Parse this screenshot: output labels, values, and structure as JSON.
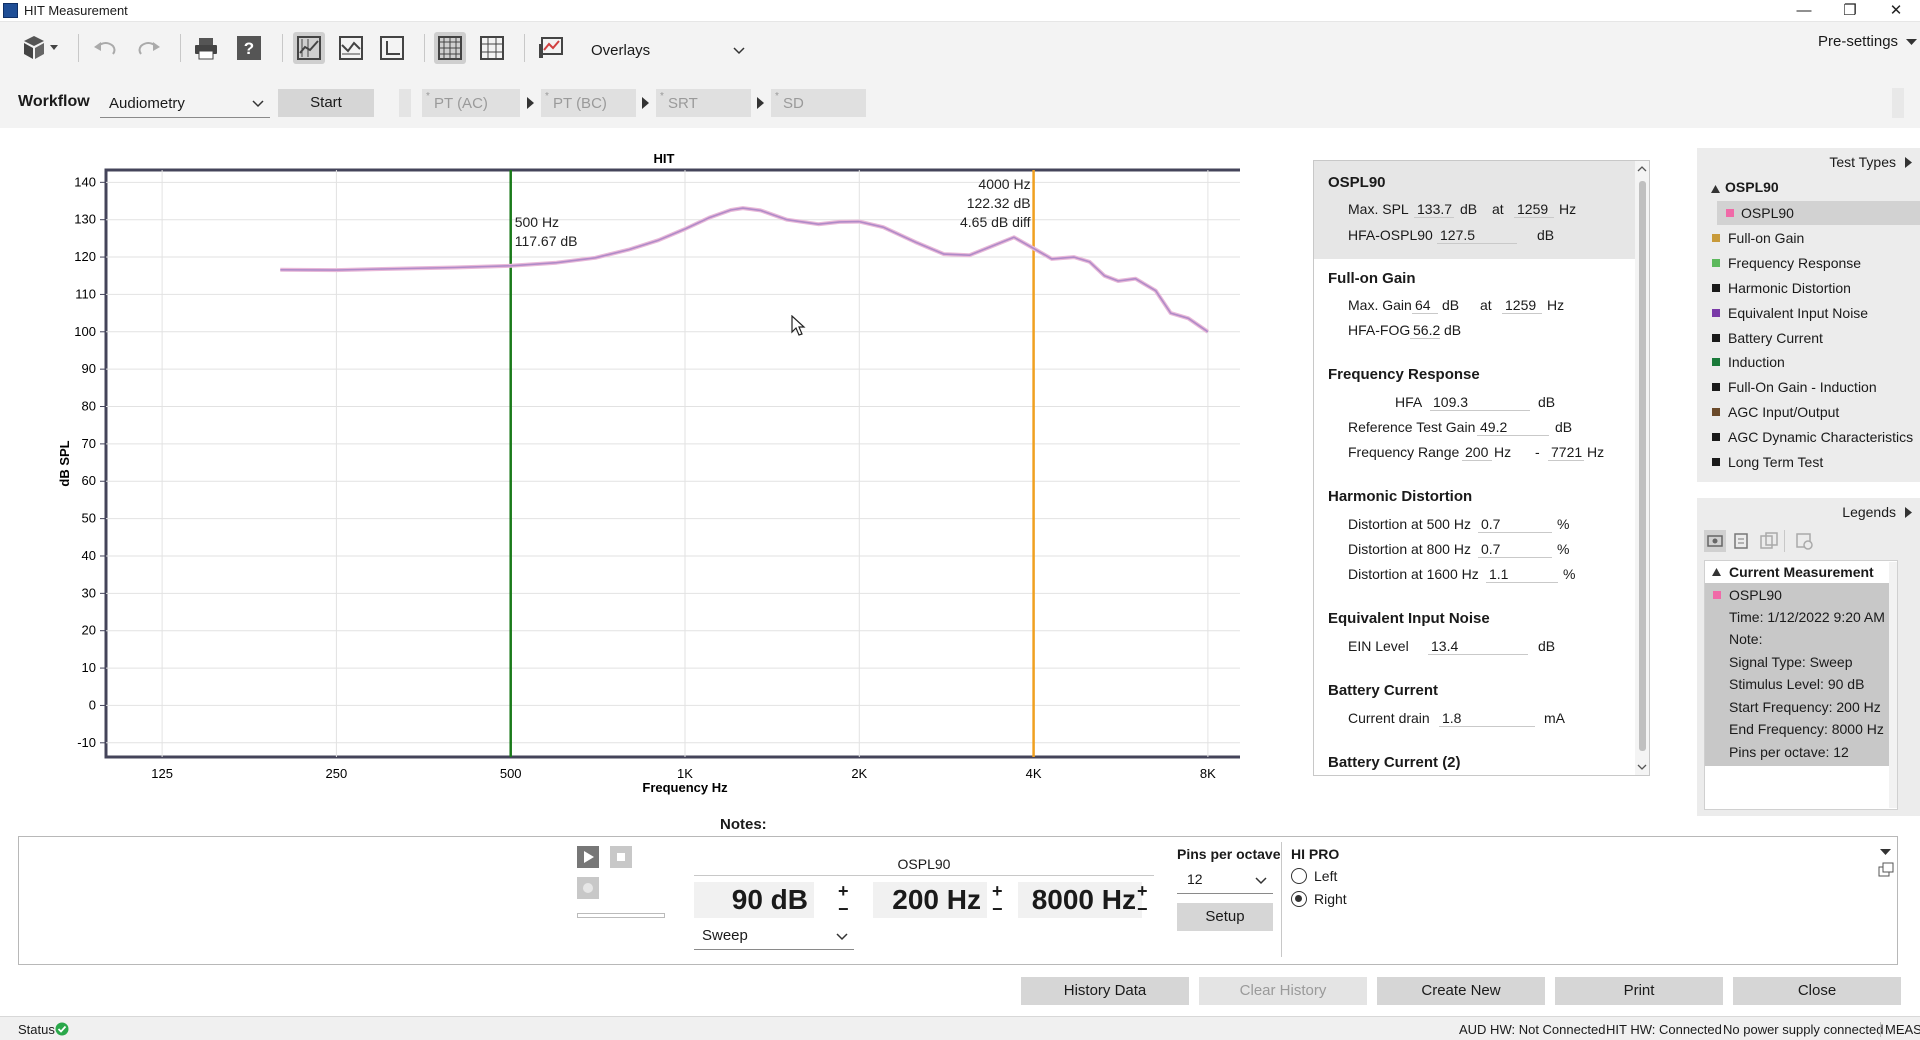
{
  "window": {
    "title": "HIT Measurement"
  },
  "toolbar": {
    "overlays_label": "Overlays",
    "presettings_label": "Pre-settings"
  },
  "workflow": {
    "label": "Workflow",
    "selected": "Audiometry",
    "start_label": "Start",
    "steps": [
      {
        "marker": "*",
        "label": "PT (AC)"
      },
      {
        "marker": "*",
        "label": "PT (BC)"
      },
      {
        "marker": "*",
        "label": "SRT"
      },
      {
        "marker": "*",
        "label": "SD"
      }
    ]
  },
  "chart_data": {
    "type": "line",
    "title": "HIT",
    "xlabel": "Frequency Hz",
    "ylabel": "dB SPL",
    "x_scale": "log",
    "xlim": [
      100,
      10000
    ],
    "ylim": [
      -10,
      140
    ],
    "x_ticks": [
      {
        "value": 125,
        "label": "125"
      },
      {
        "value": 250,
        "label": "250"
      },
      {
        "value": 500,
        "label": "500"
      },
      {
        "value": 1000,
        "label": "1K"
      },
      {
        "value": 2000,
        "label": "2K"
      },
      {
        "value": 4000,
        "label": "4K"
      },
      {
        "value": 8000,
        "label": "8K"
      }
    ],
    "y_ticks": [
      140,
      130,
      120,
      110,
      100,
      90,
      80,
      70,
      60,
      50,
      40,
      30,
      20,
      10,
      0,
      -10
    ],
    "grid": true,
    "series": [
      {
        "color": "#b08ac8",
        "points": [
          [
            200,
            116.6
          ],
          [
            250,
            116.5
          ],
          [
            300,
            116.8
          ],
          [
            400,
            117.2
          ],
          [
            500,
            117.67
          ],
          [
            600,
            118.5
          ],
          [
            700,
            119.8
          ],
          [
            800,
            122
          ],
          [
            900,
            124.5
          ],
          [
            1000,
            127.5
          ],
          [
            1100,
            130.5
          ],
          [
            1200,
            132.6
          ],
          [
            1259,
            133.1
          ],
          [
            1350,
            132.5
          ],
          [
            1500,
            130
          ],
          [
            1700,
            128.8
          ],
          [
            1850,
            129.4
          ],
          [
            2000,
            129.5
          ],
          [
            2200,
            128
          ],
          [
            2500,
            124
          ],
          [
            2800,
            120.8
          ],
          [
            3100,
            120.5
          ],
          [
            3400,
            123
          ],
          [
            3700,
            125.3
          ],
          [
            4000,
            122.32
          ],
          [
            4300,
            119.5
          ],
          [
            4700,
            120
          ],
          [
            5000,
            118.7
          ],
          [
            5300,
            115
          ],
          [
            5600,
            113.6
          ],
          [
            6000,
            114.2
          ],
          [
            6500,
            111
          ],
          [
            6900,
            105
          ],
          [
            7400,
            103.6
          ],
          [
            8000,
            100
          ]
        ]
      }
    ],
    "markers": [
      {
        "x": 500,
        "color": "#1a7a1a",
        "lines": [
          "500 Hz",
          "117.67 dB"
        ]
      },
      {
        "x": 4000,
        "color": "#f0a020",
        "lines": [
          "4000 Hz",
          "122.32 dB",
          "4.65 dB diff"
        ]
      }
    ]
  },
  "results": {
    "ospl90": {
      "title": "OSPL90",
      "max_spl_label": "Max. SPL",
      "max_spl": "133.7",
      "max_spl_unit": "dB",
      "at_label": "at",
      "max_spl_freq": "1259",
      "freq_unit": "Hz",
      "hfa_label": "HFA-OSPL90",
      "hfa": "127.5",
      "hfa_unit": "dB"
    },
    "fog": {
      "title": "Full-on Gain",
      "max_gain_label": "Max. Gain",
      "max_gain": "64",
      "max_gain_unit": "dB",
      "at_label": "at",
      "max_gain_freq": "1259",
      "freq_unit": "Hz",
      "hfa_fog_label": "HFA-FOG",
      "hfa_fog": "56.2",
      "hfa_fog_unit": "dB"
    },
    "fr": {
      "title": "Frequency Response",
      "hfa_label": "HFA",
      "hfa": "109.3",
      "hfa_unit": "dB",
      "rtg_label": "Reference Test Gain",
      "rtg": "49.2",
      "rtg_unit": "dB",
      "range_label": "Frequency Range",
      "range_low": "200",
      "range_low_unit": "Hz",
      "range_dash": "-",
      "range_high": "7721",
      "range_high_unit": "Hz"
    },
    "hd": {
      "title": "Harmonic Distortion",
      "rows": [
        {
          "label": "Distortion at 500 Hz",
          "value": "0.7",
          "unit": "%"
        },
        {
          "label": "Distortion at 800 Hz",
          "value": "0.7",
          "unit": "%"
        },
        {
          "label": "Distortion at 1600 Hz",
          "value": "1.1",
          "unit": "%"
        }
      ]
    },
    "ein": {
      "title": "Equivalent Input Noise",
      "label": "EIN Level",
      "value": "13.4",
      "unit": "dB"
    },
    "battery": {
      "title": "Battery Current",
      "label": "Current drain",
      "value": "1.8",
      "unit": "mA"
    },
    "battery2": {
      "title": "Battery Current (2)"
    }
  },
  "test_types": {
    "header": "Test Types",
    "group": "OSPL90",
    "items": [
      {
        "label": "OSPL90",
        "color": "#f06aa8",
        "selected": true
      },
      {
        "label": "Full-on Gain",
        "color": "#c89a3a"
      },
      {
        "label": "Frequency Response",
        "color": "#5cb85c"
      },
      {
        "label": "Harmonic Distortion",
        "color": "#1a1a1a"
      },
      {
        "label": "Equivalent Input Noise",
        "color": "#7a3aa8"
      },
      {
        "label": "Battery Current",
        "color": "#1a1a1a"
      },
      {
        "label": "Induction",
        "color": "#1a7a3a"
      },
      {
        "label": "Full-On Gain - Induction",
        "color": "#1a1a1a"
      },
      {
        "label": "AGC Input/Output",
        "color": "#6a4a2a"
      },
      {
        "label": "AGC Dynamic Characteristics",
        "color": "#1a1a1a"
      },
      {
        "label": "Long Term Test",
        "color": "#1a1a1a"
      }
    ]
  },
  "legends": {
    "header": "Legends",
    "group": "Current Measurement",
    "entry": {
      "name": "OSPL90",
      "color": "#f06aa8",
      "lines": [
        "Time: 1/12/2022 9:20 AM",
        "Note:",
        "Signal Type: Sweep",
        "Stimulus Level: 90 dB",
        "Start Frequency: 200 Hz",
        "End Frequency: 8000 Hz",
        "Pins per octave: 12"
      ]
    }
  },
  "controls": {
    "notes_label": "Notes:",
    "test_name": "OSPL90",
    "level": "90 dB",
    "start_freq": "200 Hz",
    "end_freq": "8000 Hz",
    "plus": "+",
    "minus": "−",
    "signal_type": "Sweep",
    "pins_label": "Pins per octave",
    "pins_value": "12",
    "setup_label": "Setup",
    "device_label": "HI PRO",
    "left_label": "Left",
    "right_label": "Right",
    "selected_side": "Right"
  },
  "footer": {
    "history": "History Data",
    "clear_history": "Clear History",
    "create_new": "Create New",
    "print": "Print",
    "close": "Close"
  },
  "status": {
    "label": "Status",
    "aud_hw": "AUD HW: Not Connected",
    "hit_hw": "HIT HW: Connected",
    "power": "No power supply connected",
    "meas": "MEAS"
  }
}
